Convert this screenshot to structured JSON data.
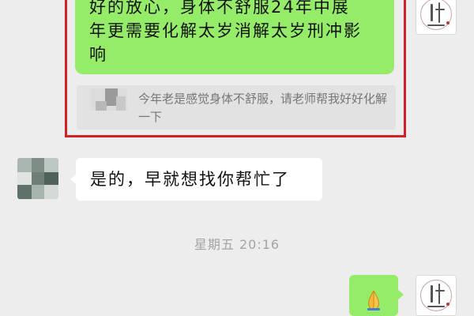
{
  "chat": {
    "outgoing_message_1": {
      "line_1": "好的放心，身体不舒服24年中展",
      "line_2": "年更需要化解太岁消解太岁刑冲影",
      "line_3": "响"
    },
    "quoted_reply": {
      "text": "今年老是感觉身体不舒服，请老师帮我好好化解一下"
    },
    "incoming_message_1": {
      "text": "是的，早就想找你帮忙了"
    },
    "timestamp": "星期五 20:16",
    "outgoing_message_2": {
      "emoji": "🙏"
    }
  },
  "self_avatar": {
    "icon": "seal-calligraphy-icon"
  },
  "colors": {
    "highlight_border": "#d71f27",
    "outgoing_bubble": "#95ec69",
    "incoming_bubble": "#ffffff",
    "background": "#ededed",
    "timestamp_text": "#a4a4a4"
  }
}
